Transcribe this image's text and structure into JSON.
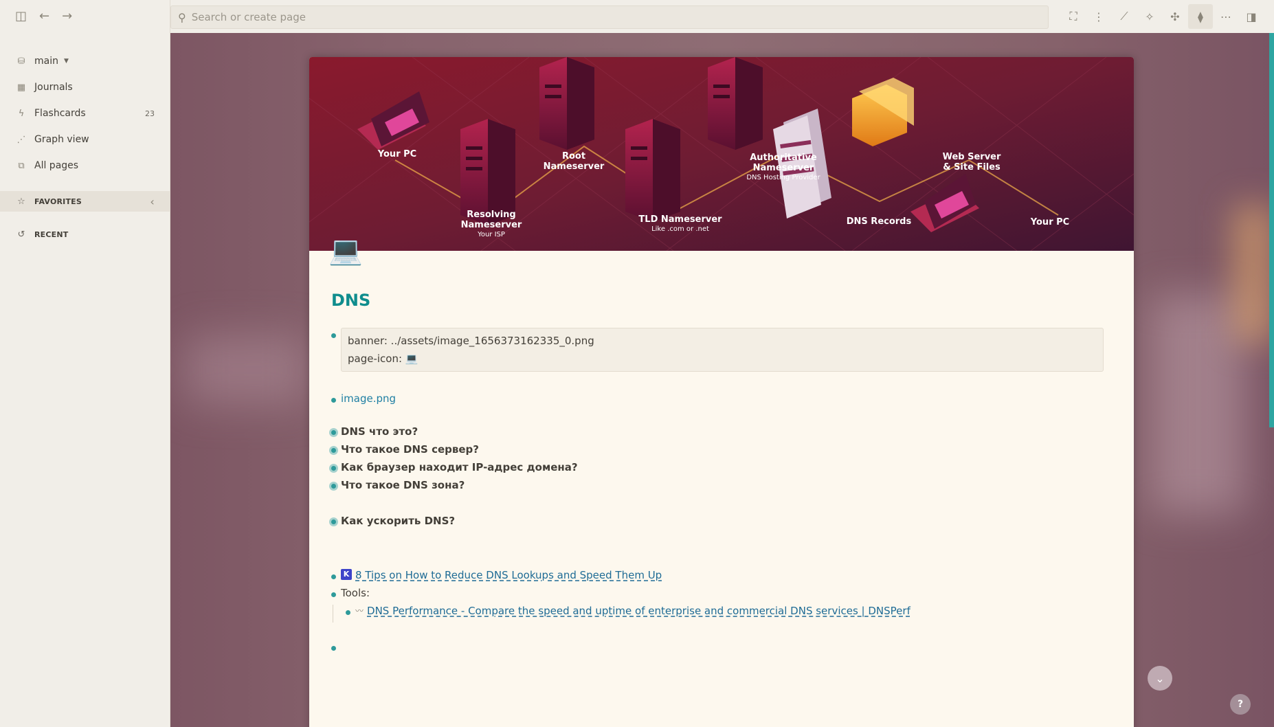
{
  "sidebar": {
    "graph_name": "main",
    "items": [
      {
        "label": "Journals",
        "icon": "calendar-icon"
      },
      {
        "label": "Flashcards",
        "icon": "flash-icon",
        "count": "23"
      },
      {
        "label": "Graph view",
        "icon": "graph-icon"
      },
      {
        "label": "All pages",
        "icon": "pages-icon"
      }
    ],
    "favorites_label": "FAVORITES",
    "recent_label": "RECENT"
  },
  "header": {
    "search_placeholder": "Search or create page"
  },
  "banner": {
    "labels": {
      "pc1": "Your PC",
      "resolving1": "Resolving",
      "resolving2": "Nameserver",
      "resolving_sub": "Your ISP",
      "root1": "Root",
      "root2": "Nameserver",
      "tld": "TLD Nameserver",
      "tld_sub": "Like .com or .net",
      "auth1": "Authoritative",
      "auth2": "Nameserver",
      "auth_sub": "DNS Hosting Provider",
      "records": "DNS Records",
      "web1": "Web Server",
      "web2": "& Site Files",
      "pc2": "Your PC"
    }
  },
  "page": {
    "icon": "💻",
    "title": "DNS",
    "properties": {
      "banner_line": "banner: ../assets/image_1656373162335_0.png",
      "icon_line": "page-icon: 💻"
    },
    "image_link": "image.png",
    "questions": [
      "DNS что это?",
      "Что такое DNS сервер?",
      "Как браузер находит IP-адрес домена?",
      "Что такое DNS зона?"
    ],
    "speed_question": "Как ускорить DNS?",
    "tip_badge": "K",
    "tip_link": "8 Tips on How to Reduce DNS Lookups and Speed Them Up",
    "tools_label": "Tools:",
    "tool_icon": "〰",
    "tool_link": "DNS Performance - Compare the speed and uptime of enterprise and commercial DNS services | DNSPerf"
  },
  "help_label": "?"
}
